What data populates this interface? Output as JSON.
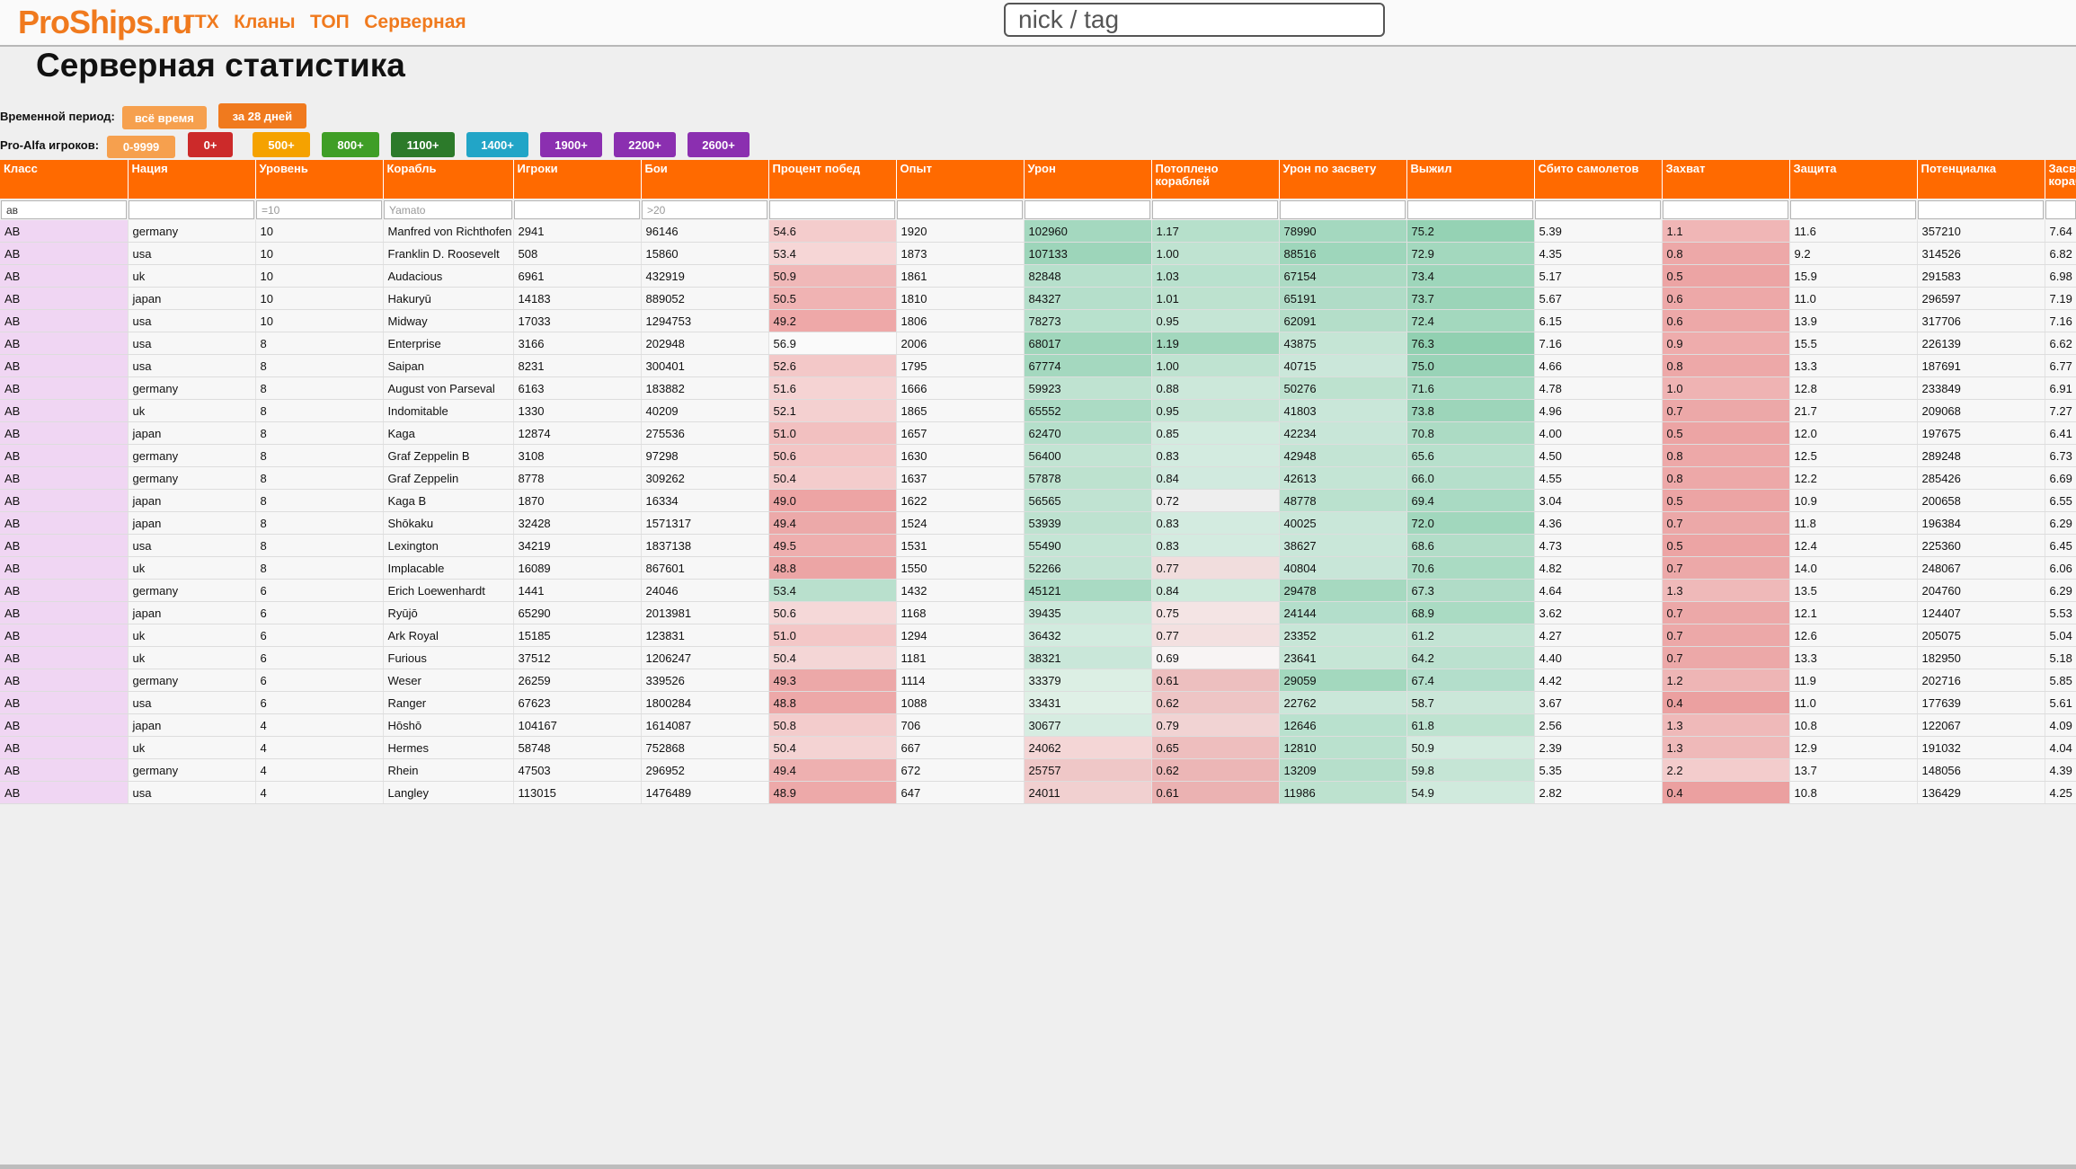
{
  "header": {
    "logo": "ProShips.ru",
    "nav": [
      "ТТХ",
      "Кланы",
      "ТОП",
      "Серверная"
    ],
    "search_placeholder": "nick / tag"
  },
  "page_title": "Серверная статистика",
  "period": {
    "label": "Временной период:",
    "buttons": [
      {
        "label": "всё время",
        "color": "#f6a04e",
        "selected": false
      },
      {
        "label": "за 28 дней",
        "color": "#f07a1e",
        "selected": true
      }
    ]
  },
  "players": {
    "label": "Pro-Alfa игроков:",
    "buttons": [
      {
        "label": "0-9999",
        "color": "#f6a04e"
      },
      {
        "label": "0+",
        "color": "#cc2a2a"
      },
      {
        "label": "500+",
        "color": "#f5a200"
      },
      {
        "label": "800+",
        "color": "#3f9e26"
      },
      {
        "label": "1100+",
        "color": "#2c7a2a"
      },
      {
        "label": "1400+",
        "color": "#22a5c7"
      },
      {
        "label": "1900+",
        "color": "#8b2fb0"
      },
      {
        "label": "2200+",
        "color": "#8b2fb0"
      },
      {
        "label": "2600+",
        "color": "#8b2fb0"
      }
    ]
  },
  "table": {
    "columns": [
      "Класс",
      "Нация",
      "Уровень",
      "Корабль",
      "Игроки",
      "Бои",
      "Процент побед",
      "Опыт",
      "Урон",
      "Потоплено кораблей",
      "Урон по засвету",
      "Выжил",
      "Сбито самолетов",
      "Захват",
      "Защита",
      "Потенциалка",
      "Засвет кораблей"
    ],
    "filters": [
      {
        "value": "ав",
        "placeholder": ""
      },
      {
        "value": "",
        "placeholder": ""
      },
      {
        "value": "",
        "placeholder": "=10"
      },
      {
        "value": "",
        "placeholder": "Yamato"
      },
      {
        "value": "",
        "placeholder": ""
      },
      {
        "value": "",
        "placeholder": ">20"
      },
      {
        "value": "",
        "placeholder": ""
      },
      {
        "value": "",
        "placeholder": ""
      },
      {
        "value": "",
        "placeholder": ""
      },
      {
        "value": "",
        "placeholder": ""
      },
      {
        "value": "",
        "placeholder": ""
      },
      {
        "value": "",
        "placeholder": ""
      },
      {
        "value": "",
        "placeholder": ""
      },
      {
        "value": "",
        "placeholder": ""
      },
      {
        "value": "",
        "placeholder": ""
      },
      {
        "value": "",
        "placeholder": ""
      },
      {
        "value": "",
        "placeholder": ""
      }
    ],
    "rows": [
      [
        "АВ",
        "germany",
        "10",
        "Manfred von Richthofen",
        "2941",
        "96146",
        "54.6",
        "1920",
        "102960",
        "1.17",
        "78990",
        "75.2",
        "5.39",
        "1.1",
        "11.6",
        "357210",
        "7.64"
      ],
      [
        "АВ",
        "usa",
        "10",
        "Franklin D. Roosevelt",
        "508",
        "15860",
        "53.4",
        "1873",
        "107133",
        "1.00",
        "88516",
        "72.9",
        "4.35",
        "0.8",
        "9.2",
        "314526",
        "6.82"
      ],
      [
        "АВ",
        "uk",
        "10",
        "Audacious",
        "6961",
        "432919",
        "50.9",
        "1861",
        "82848",
        "1.03",
        "67154",
        "73.4",
        "5.17",
        "0.5",
        "15.9",
        "291583",
        "6.98"
      ],
      [
        "АВ",
        "japan",
        "10",
        "Hakuryū",
        "14183",
        "889052",
        "50.5",
        "1810",
        "84327",
        "1.01",
        "65191",
        "73.7",
        "5.67",
        "0.6",
        "11.0",
        "296597",
        "7.19"
      ],
      [
        "АВ",
        "usa",
        "10",
        "Midway",
        "17033",
        "1294753",
        "49.2",
        "1806",
        "78273",
        "0.95",
        "62091",
        "72.4",
        "6.15",
        "0.6",
        "13.9",
        "317706",
        "7.16"
      ],
      [
        "АВ",
        "usa",
        "8",
        "Enterprise",
        "3166",
        "202948",
        "56.9",
        "2006",
        "68017",
        "1.19",
        "43875",
        "76.3",
        "7.16",
        "0.9",
        "15.5",
        "226139",
        "6.62"
      ],
      [
        "АВ",
        "usa",
        "8",
        "Saipan",
        "8231",
        "300401",
        "52.6",
        "1795",
        "67774",
        "1.00",
        "40715",
        "75.0",
        "4.66",
        "0.8",
        "13.3",
        "187691",
        "6.77"
      ],
      [
        "АВ",
        "germany",
        "8",
        "August von Parseval",
        "6163",
        "183882",
        "51.6",
        "1666",
        "59923",
        "0.88",
        "50276",
        "71.6",
        "4.78",
        "1.0",
        "12.8",
        "233849",
        "6.91"
      ],
      [
        "АВ",
        "uk",
        "8",
        "Indomitable",
        "1330",
        "40209",
        "52.1",
        "1865",
        "65552",
        "0.95",
        "41803",
        "73.8",
        "4.96",
        "0.7",
        "21.7",
        "209068",
        "7.27"
      ],
      [
        "АВ",
        "japan",
        "8",
        "Kaga",
        "12874",
        "275536",
        "51.0",
        "1657",
        "62470",
        "0.85",
        "42234",
        "70.8",
        "4.00",
        "0.5",
        "12.0",
        "197675",
        "6.41"
      ],
      [
        "АВ",
        "germany",
        "8",
        "Graf Zeppelin B",
        "3108",
        "97298",
        "50.6",
        "1630",
        "56400",
        "0.83",
        "42948",
        "65.6",
        "4.50",
        "0.8",
        "12.5",
        "289248",
        "6.73"
      ],
      [
        "АВ",
        "germany",
        "8",
        "Graf Zeppelin",
        "8778",
        "309262",
        "50.4",
        "1637",
        "57878",
        "0.84",
        "42613",
        "66.0",
        "4.55",
        "0.8",
        "12.2",
        "285426",
        "6.69"
      ],
      [
        "АВ",
        "japan",
        "8",
        "Kaga B",
        "1870",
        "16334",
        "49.0",
        "1622",
        "56565",
        "0.72",
        "48778",
        "69.4",
        "3.04",
        "0.5",
        "10.9",
        "200658",
        "6.55"
      ],
      [
        "АВ",
        "japan",
        "8",
        "Shōkaku",
        "32428",
        "1571317",
        "49.4",
        "1524",
        "53939",
        "0.83",
        "40025",
        "72.0",
        "4.36",
        "0.7",
        "11.8",
        "196384",
        "6.29"
      ],
      [
        "АВ",
        "usa",
        "8",
        "Lexington",
        "34219",
        "1837138",
        "49.5",
        "1531",
        "55490",
        "0.83",
        "38627",
        "68.6",
        "4.73",
        "0.5",
        "12.4",
        "225360",
        "6.45"
      ],
      [
        "АВ",
        "uk",
        "8",
        "Implacable",
        "16089",
        "867601",
        "48.8",
        "1550",
        "52266",
        "0.77",
        "40804",
        "70.6",
        "4.82",
        "0.7",
        "14.0",
        "248067",
        "6.06"
      ],
      [
        "АВ",
        "germany",
        "6",
        "Erich Loewenhardt",
        "1441",
        "24046",
        "53.4",
        "1432",
        "45121",
        "0.84",
        "29478",
        "67.3",
        "4.64",
        "1.3",
        "13.5",
        "204760",
        "6.29"
      ],
      [
        "АВ",
        "japan",
        "6",
        "Ryūjō",
        "65290",
        "2013981",
        "50.6",
        "1168",
        "39435",
        "0.75",
        "24144",
        "68.9",
        "3.62",
        "0.7",
        "12.1",
        "124407",
        "5.53"
      ],
      [
        "АВ",
        "uk",
        "6",
        "Ark Royal",
        "15185",
        "123831",
        "51.0",
        "1294",
        "36432",
        "0.77",
        "23352",
        "61.2",
        "4.27",
        "0.7",
        "12.6",
        "205075",
        "5.04"
      ],
      [
        "АВ",
        "uk",
        "6",
        "Furious",
        "37512",
        "1206247",
        "50.4",
        "1181",
        "38321",
        "0.69",
        "23641",
        "64.2",
        "4.40",
        "0.7",
        "13.3",
        "182950",
        "5.18"
      ],
      [
        "АВ",
        "germany",
        "6",
        "Weser",
        "26259",
        "339526",
        "49.3",
        "1114",
        "33379",
        "0.61",
        "29059",
        "67.4",
        "4.42",
        "1.2",
        "11.9",
        "202716",
        "5.85"
      ],
      [
        "АВ",
        "usa",
        "6",
        "Ranger",
        "67623",
        "1800284",
        "48.8",
        "1088",
        "33431",
        "0.62",
        "22762",
        "58.7",
        "3.67",
        "0.4",
        "11.0",
        "177639",
        "5.61"
      ],
      [
        "АВ",
        "japan",
        "4",
        "Hōshō",
        "104167",
        "1614087",
        "50.8",
        "706",
        "30677",
        "0.79",
        "12646",
        "61.8",
        "2.56",
        "1.3",
        "10.8",
        "122067",
        "4.09"
      ],
      [
        "АВ",
        "uk",
        "4",
        "Hermes",
        "58748",
        "752868",
        "50.4",
        "667",
        "24062",
        "0.65",
        "12810",
        "50.9",
        "2.39",
        "1.3",
        "12.9",
        "191032",
        "4.04"
      ],
      [
        "АВ",
        "germany",
        "4",
        "Rhein",
        "47503",
        "296952",
        "49.4",
        "672",
        "25757",
        "0.62",
        "13209",
        "59.8",
        "5.35",
        "2.2",
        "13.7",
        "148056",
        "4.39"
      ],
      [
        "АВ",
        "usa",
        "4",
        "Langley",
        "113015",
        "1476489",
        "48.9",
        "647",
        "24011",
        "0.61",
        "11986",
        "54.9",
        "2.82",
        "0.4",
        "10.8",
        "136429",
        "4.25"
      ]
    ],
    "cell_colors": {
      "wr": [
        "#f4cccc",
        "#f6d6d6",
        "#f0b8b8",
        "#f0b3b3",
        "#eea8a8",
        "#fafafa",
        "#f3c8c8",
        "#f5d3d3",
        "#f4d0d0",
        "#f2c0c0",
        "#f3c5c5",
        "#f4cccc",
        "#eda4a4",
        "#eca9a9",
        "#eeaeae",
        "#eca5a5",
        "#b9e0cd",
        "#f5d8d8",
        "#f3c7c7",
        "#f4d6d6",
        "#eca8a8",
        "#eda8a8",
        "#f3cccc",
        "#f4d3d3",
        "#eeb0b0",
        "#eda9a9"
      ],
      "dmg": [
        "#a4d8bf",
        "#9dd5ba",
        "#b7e0cc",
        "#b5dfcb",
        "#b8e1cd",
        "#9fd6bb",
        "#a4d8bf",
        "#bfe3d1",
        "#abdbc4",
        "#b5dfcb",
        "#c2e4d3",
        "#bde2cf",
        "#c0e3d2",
        "#bee2d0",
        "#c4e5d5",
        "#c3e4d4",
        "#a9dac3",
        "#cbe8da",
        "#d2ebdf",
        "#c9e7d9",
        "#dcefe4",
        "#dff0e6",
        "#d6ece1",
        "#f4d6d6",
        "#efc7c7",
        "#f1d0d0"
      ],
      "kills": [
        "#b6e0cb",
        "#bfe3d1",
        "#b9e1ce",
        "#bde2cf",
        "#c5e5d5",
        "#a2d7bd",
        "#bfe3d1",
        "#cce8da",
        "#c5e5d5",
        "#d2ebdf",
        "#d3ebe0",
        "#d1eadf",
        "#eeeeee",
        "#d3ebe0",
        "#d3ebe0",
        "#f1dddd",
        "#cfeadc",
        "#f4e4e4",
        "#f3e0e0",
        "#f8f4f4",
        "#edbfbf",
        "#eec5c5",
        "#f1d3d3",
        "#eebebe",
        "#ecb6b6",
        "#ebb2b2"
      ],
      "spot": [
        "#a4d8bf",
        "#9ed6bb",
        "#acdbc4",
        "#b0dcc7",
        "#b4dec9",
        "#c5e5d5",
        "#cbe7da",
        "#bde2cf",
        "#c9e7d9",
        "#c8e6d8",
        "#c3e4d4",
        "#c4e5d5",
        "#bae1ce",
        "#c9e7d9",
        "#c9e7d9",
        "#c8e6d8",
        "#a6d9c0",
        "#b3decb",
        "#c7e6d7",
        "#c6e6d6",
        "#a3d8be",
        "#cae7d9",
        "#b9e1ce",
        "#bae1ce",
        "#b6dfcb",
        "#bde2cf"
      ],
      "surv": [
        "#95d2b4",
        "#a3d8be",
        "#9ed6bb",
        "#9bd4b8",
        "#a3d8be",
        "#91d0b1",
        "#99d3b7",
        "#a8dac2",
        "#9dd5ba",
        "#acdbc4",
        "#b7e0cc",
        "#b5dfcb",
        "#a9dac3",
        "#a1d7bd",
        "#b2ddc8",
        "#aadbc3",
        "#b0dcc7",
        "#aadbc3",
        "#c3e4d4",
        "#bbe1cf",
        "#b3decb",
        "#cbe7d9",
        "#bee3d0",
        "#d3ebdf",
        "#c5e5d5",
        "#d0eadd"
      ],
      "cap": [
        "#f0b6b6",
        "#eda8a8",
        "#eca4a4",
        "#eda8a8",
        "#eda8a8",
        "#eeacac",
        "#eda8a8",
        "#efb3b3",
        "#eca8a8",
        "#eca4a4",
        "#eda8a8",
        "#eda8a8",
        "#eca4a4",
        "#eca8a8",
        "#eca4a4",
        "#eca8a8",
        "#efb9b9",
        "#eca8a8",
        "#eca8a8",
        "#eca8a8",
        "#eeb5b5",
        "#eba0a0",
        "#efb9b9",
        "#efb9b9",
        "#f3cccc",
        "#eba0a0"
      ]
    }
  }
}
